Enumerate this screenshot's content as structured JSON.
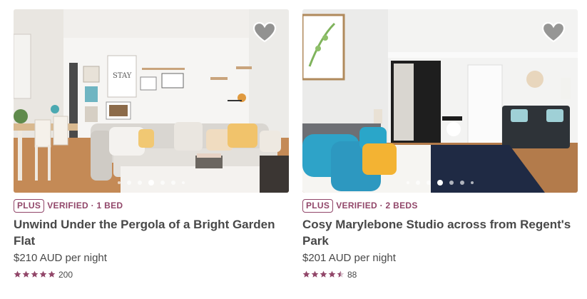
{
  "listings": [
    {
      "badge": "PLUS",
      "verified": "VERIFIED · 1 BED",
      "title": "Unwind Under the Pergola of a Bright Garden Flat",
      "price": "$210 AUD per night",
      "rating": 5,
      "reviews": "200",
      "photo_index": 4,
      "photo_count": 7,
      "saved": false
    },
    {
      "badge": "PLUS",
      "verified": "VERIFIED · 2 BEDS",
      "title": "Cosy Marylebone Studio across from Regent's Park",
      "price": "$201 AUD per night",
      "rating": 4.5,
      "reviews": "88",
      "photo_index": 4,
      "photo_count": 7,
      "saved": false
    }
  ],
  "colors": {
    "accent": "#914669",
    "text": "#484848",
    "star": "#914669"
  },
  "icons": {
    "save": "heart-icon",
    "star": "star-icon"
  }
}
